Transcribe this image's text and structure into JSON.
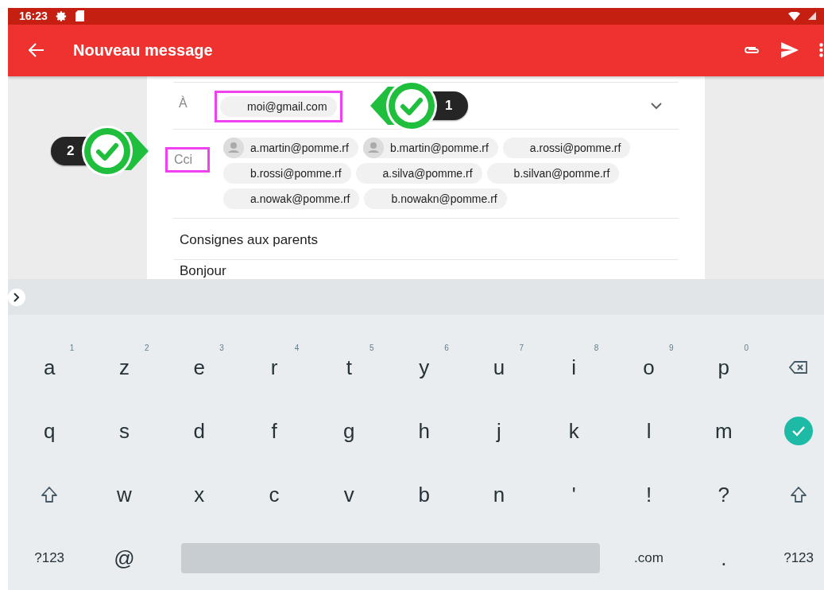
{
  "status_bar": {
    "time": "16:23"
  },
  "toolbar": {
    "title": "Nouveau message"
  },
  "compose": {
    "to": {
      "label": "À",
      "highlighted": true,
      "recipients": [
        {
          "address": "moi@gmail.com",
          "avatar": false
        }
      ]
    },
    "bcc": {
      "label": "Cci",
      "highlighted": true,
      "recipients": [
        {
          "address": "a.martin@pomme.rf",
          "avatar": true
        },
        {
          "address": "b.martin@pomme.rf",
          "avatar": true
        },
        {
          "address": "a.rossi@pomme.rf",
          "avatar": false
        },
        {
          "address": "b.rossi@pomme.rf",
          "avatar": false
        },
        {
          "address": "a.silva@pomme.rf",
          "avatar": false
        },
        {
          "address": "b.silvan@pomme.rf",
          "avatar": false
        },
        {
          "address": "a.nowak@pomme.rf",
          "avatar": false
        },
        {
          "address": "b.nowakn@pomme.rf",
          "avatar": false
        }
      ]
    },
    "subject": "Consignes aux parents",
    "body": "Bonjour"
  },
  "callouts": [
    {
      "number": "1",
      "kind": "right"
    },
    {
      "number": "2",
      "kind": "left"
    }
  ],
  "keyboard": {
    "rows": [
      [
        {
          "kind": "letter",
          "label": "a",
          "hint": "1"
        },
        {
          "kind": "letter",
          "label": "z",
          "hint": "2"
        },
        {
          "kind": "letter",
          "label": "e",
          "hint": "3"
        },
        {
          "kind": "letter",
          "label": "r",
          "hint": "4"
        },
        {
          "kind": "letter",
          "label": "t",
          "hint": "5"
        },
        {
          "kind": "letter",
          "label": "y",
          "hint": "6"
        },
        {
          "kind": "letter",
          "label": "u",
          "hint": "7"
        },
        {
          "kind": "letter",
          "label": "i",
          "hint": "8"
        },
        {
          "kind": "letter",
          "label": "o",
          "hint": "9"
        },
        {
          "kind": "letter",
          "label": "p",
          "hint": "0"
        },
        {
          "kind": "backspace"
        }
      ],
      [
        {
          "kind": "letter",
          "label": "q"
        },
        {
          "kind": "letter",
          "label": "s"
        },
        {
          "kind": "letter",
          "label": "d"
        },
        {
          "kind": "letter",
          "label": "f"
        },
        {
          "kind": "letter",
          "label": "g"
        },
        {
          "kind": "letter",
          "label": "h"
        },
        {
          "kind": "letter",
          "label": "j"
        },
        {
          "kind": "letter",
          "label": "k"
        },
        {
          "kind": "letter",
          "label": "l"
        },
        {
          "kind": "letter",
          "label": "m"
        },
        {
          "kind": "enter"
        }
      ],
      [
        {
          "kind": "shift"
        },
        {
          "kind": "letter",
          "label": "w"
        },
        {
          "kind": "letter",
          "label": "x"
        },
        {
          "kind": "letter",
          "label": "c"
        },
        {
          "kind": "letter",
          "label": "v"
        },
        {
          "kind": "letter",
          "label": "b"
        },
        {
          "kind": "letter",
          "label": "n"
        },
        {
          "kind": "letter",
          "label": "'"
        },
        {
          "kind": "letter",
          "label": "!"
        },
        {
          "kind": "letter",
          "label": "?"
        },
        {
          "kind": "shift"
        }
      ]
    ],
    "bottom_bar": [
      {
        "kind": "small",
        "label": "?123"
      },
      {
        "kind": "letter",
        "label": "@"
      },
      {
        "kind": "space"
      },
      {
        "kind": "small",
        "label": ".com"
      },
      {
        "kind": "letter",
        "label": "."
      },
      {
        "kind": "small",
        "label": "?123"
      }
    ]
  }
}
